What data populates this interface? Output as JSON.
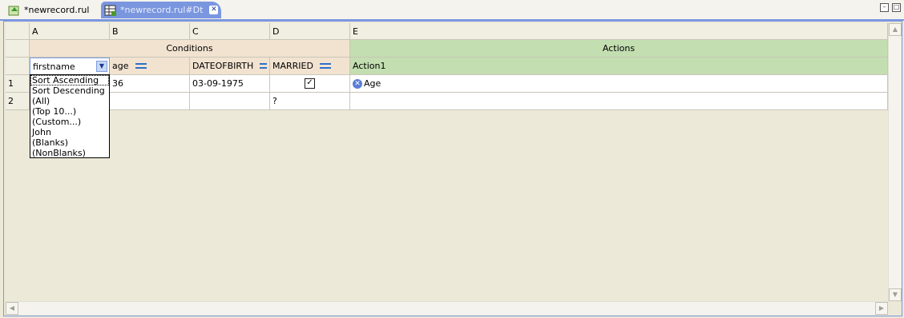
{
  "tabs": [
    {
      "label": "*newrecord.rul",
      "icon": "rule-file-icon",
      "active": false
    },
    {
      "label": "*newrecord.rul#Dt",
      "icon": "decision-table-icon",
      "active": true
    }
  ],
  "window_controls": {
    "minimize": "minimize-icon",
    "maximize": "maximize-icon"
  },
  "columns": [
    "A",
    "B",
    "C",
    "D",
    "E"
  ],
  "groups": {
    "conditions": "Conditions",
    "actions": "Actions"
  },
  "headers": {
    "a": "firstname",
    "b": "age",
    "c": "DATEOFBIRTH",
    "d": "MARRIED",
    "e": "Action1"
  },
  "rows": [
    {
      "num": "1",
      "a": "",
      "b": "36",
      "c": "03-09-1975",
      "d_checked": true,
      "e": "Age"
    },
    {
      "num": "2",
      "a": "",
      "b": "",
      "c": "",
      "d": "?",
      "e": ""
    }
  ],
  "dropdown": {
    "options": [
      "Sort Ascending",
      "Sort Descending",
      "(All)",
      "(Top 10...)",
      "(Custom...)",
      "John",
      "(Blanks)",
      "(NonBlanks)"
    ],
    "selected_index": 0
  },
  "colors": {
    "conditions": "#f2e3d1",
    "actions": "#c3deb0",
    "active_tab": "#7a96df"
  }
}
